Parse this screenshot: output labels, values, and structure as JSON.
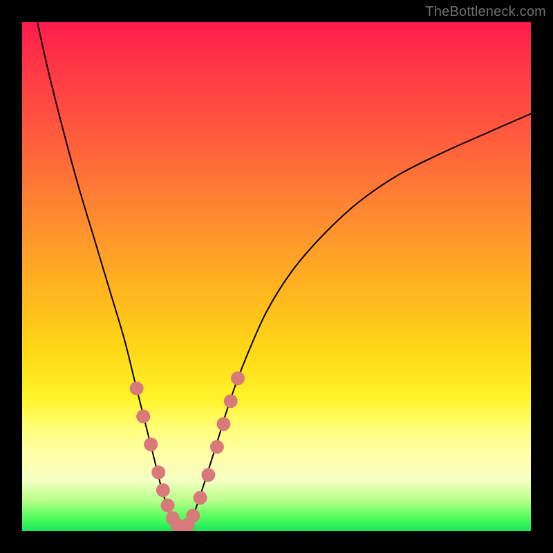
{
  "watermark": "TheBottleneck.com",
  "chart_data": {
    "type": "line",
    "title": "",
    "xlabel": "",
    "ylabel": "",
    "xlim": [
      0,
      100
    ],
    "ylim": [
      0,
      100
    ],
    "grid": false,
    "series": [
      {
        "name": "main-curve",
        "color": "#000000",
        "x": [
          3,
          5,
          8,
          11,
          14,
          17,
          20,
          22,
          24,
          26,
          27.5,
          29,
          30,
          31,
          32,
          33,
          34,
          36,
          38.5,
          41,
          44,
          48,
          53,
          59,
          66,
          74,
          83,
          92,
          100
        ],
        "y": [
          100,
          91,
          79,
          68,
          58,
          48,
          38,
          30,
          22,
          14,
          8,
          3.5,
          1.2,
          0.3,
          0.3,
          1.5,
          4,
          10,
          18,
          26,
          34,
          43,
          51,
          58,
          64.5,
          70,
          74.5,
          78.5,
          82
        ]
      },
      {
        "name": "marker-cluster",
        "color": "#d97a7a",
        "type": "scatter",
        "x": [
          22.5,
          23.8,
          25.3,
          26.8,
          27.7,
          28.6,
          29.6,
          30.6,
          31.6,
          32.6,
          33.6,
          35.0,
          36.6,
          38.3,
          39.6,
          41.0,
          42.4
        ],
        "y": [
          28.0,
          22.5,
          17.0,
          11.5,
          8.0,
          5.0,
          2.5,
          1.0,
          0.6,
          1.2,
          3.0,
          6.5,
          11.0,
          16.5,
          21.0,
          25.5,
          30.0
        ]
      }
    ],
    "background_gradient_stops": [
      {
        "pos": 0.0,
        "color": "#ff1a4d"
      },
      {
        "pos": 0.08,
        "color": "#ff3546"
      },
      {
        "pos": 0.22,
        "color": "#ff5a3e"
      },
      {
        "pos": 0.38,
        "color": "#ff8a30"
      },
      {
        "pos": 0.52,
        "color": "#ffb320"
      },
      {
        "pos": 0.64,
        "color": "#ffd616"
      },
      {
        "pos": 0.74,
        "color": "#fff42a"
      },
      {
        "pos": 0.8,
        "color": "#ffff7a"
      },
      {
        "pos": 0.85,
        "color": "#ffffa8"
      },
      {
        "pos": 0.9,
        "color": "#f6ffc4"
      },
      {
        "pos": 0.94,
        "color": "#b8ff8a"
      },
      {
        "pos": 0.97,
        "color": "#5dff60"
      },
      {
        "pos": 1.0,
        "color": "#18e85a"
      }
    ]
  }
}
